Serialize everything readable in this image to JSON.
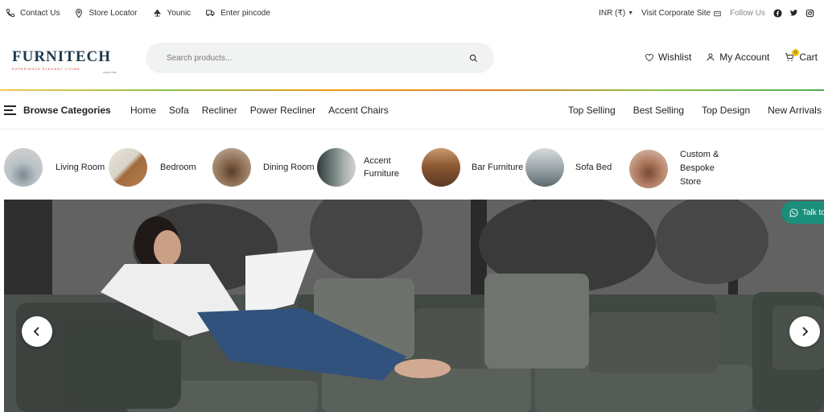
{
  "topbar": {
    "contact_us": "Contact Us",
    "store_locator": "Store Locator",
    "younic": "Younic",
    "enter_pincode": "Enter pincode",
    "currency": "INR (₹)",
    "corporate": "Visit Corporate Site",
    "follow_us": "Follow Us"
  },
  "logo": {
    "main": "FURNITECH",
    "tagline": "EXPERIENCE ELEGANT LIVING",
    "since": "SINCE 1996"
  },
  "search": {
    "placeholder": "Search products..."
  },
  "header": {
    "wishlist": "Wishlist",
    "account": "My Account",
    "cart": "Cart",
    "cart_count": "0"
  },
  "nav": {
    "browse": "Browse Categories",
    "left": [
      "Home",
      "Sofa",
      "Recliner",
      "Power Recliner",
      "Accent Chairs"
    ],
    "right": [
      "Top Selling",
      "Best Selling",
      "Top Design",
      "New Arrivals"
    ]
  },
  "categories": [
    {
      "line1": "Living Room",
      "line2": "",
      "line3": ""
    },
    {
      "line1": "Bedroom",
      "line2": "",
      "line3": ""
    },
    {
      "line1": "Dining Room",
      "line2": "",
      "line3": ""
    },
    {
      "line1": "Accent",
      "line2": "Furniture",
      "line3": ""
    },
    {
      "line1": "Bar Furniture",
      "line2": "",
      "line3": ""
    },
    {
      "line1": "Sofa Bed",
      "line2": "",
      "line3": ""
    },
    {
      "line1": "Custom &",
      "line2": "Bespoke",
      "line3": "Store"
    }
  ],
  "hero": {
    "talk": "Talk to"
  },
  "colors": {
    "accent": "#1e3a4c",
    "whatsapp": "#1a8f7b",
    "search_bg": "#f1f3f2"
  }
}
